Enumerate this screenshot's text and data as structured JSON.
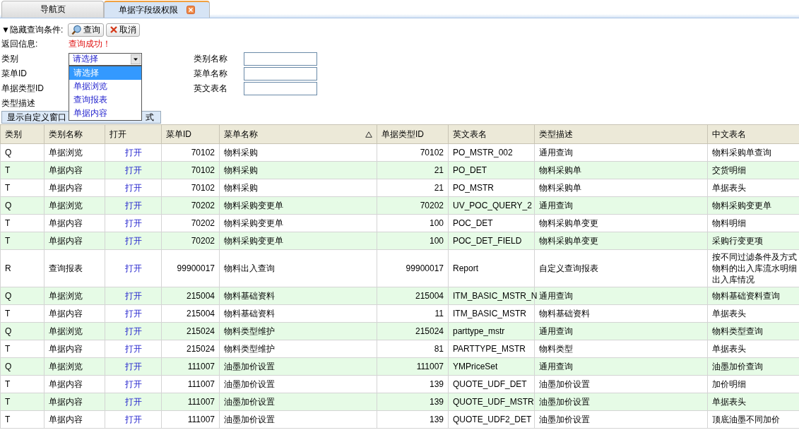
{
  "tabs": [
    {
      "label": "导航页",
      "selected": false,
      "closable": false
    },
    {
      "label": "单据字段级权限",
      "selected": true,
      "closable": true
    }
  ],
  "query_bar": {
    "toggle": "▼隐藏查询条件:",
    "buttons": [
      {
        "kind": "search",
        "label": "查询"
      },
      {
        "kind": "cancel",
        "label": "取消"
      }
    ]
  },
  "return_info": {
    "label": "返回信息:",
    "message": "查询成功！"
  },
  "filters_left": [
    {
      "label": "类别",
      "kind": "select",
      "value": "请选择",
      "expanded": true
    },
    {
      "label": "菜单ID",
      "kind": "hidden"
    },
    {
      "label": "单据类型ID",
      "kind": "hidden"
    },
    {
      "label": "类型描述",
      "kind": "hidden"
    }
  ],
  "filters_right": [
    {
      "label": "类别名称"
    },
    {
      "label": "菜单名称"
    },
    {
      "label": "英文表名"
    }
  ],
  "dropdown_options": [
    {
      "label": "请选择",
      "selected": true
    },
    {
      "label": "单据浏览",
      "selected": false
    },
    {
      "label": "查询报表",
      "selected": false
    },
    {
      "label": "单据内容",
      "selected": false
    }
  ],
  "custom_button": {
    "visible_parts": [
      "显示自定义窗口",
      "式"
    ]
  },
  "table": {
    "columns": [
      {
        "label": "类别",
        "sorted": false
      },
      {
        "label": "类别名称",
        "sorted": false
      },
      {
        "label": "打开",
        "sorted": false
      },
      {
        "label": "菜单ID",
        "sorted": false
      },
      {
        "label": "菜单名称",
        "sorted": true
      },
      {
        "label": "单据类型ID",
        "sorted": false
      },
      {
        "label": "英文表名",
        "sorted": false
      },
      {
        "label": "类型描述",
        "sorted": false
      },
      {
        "label": "中文表名",
        "sorted": false
      }
    ],
    "rows": [
      {
        "cells": [
          "Q",
          "单据浏览",
          "打开",
          "70102",
          "物料采购",
          "70102",
          "PO_MSTR_002",
          "通用查询",
          [
            "物料采购单查询"
          ]
        ]
      },
      {
        "cells": [
          "T",
          "单据内容",
          "打开",
          "70102",
          "物料采购",
          "21",
          "PO_DET",
          "物料采购单",
          [
            "交货明细"
          ]
        ]
      },
      {
        "cells": [
          "T",
          "单据内容",
          "打开",
          "70102",
          "物料采购",
          "21",
          "PO_MSTR",
          "物料采购单",
          [
            "单据表头"
          ]
        ]
      },
      {
        "cells": [
          "Q",
          "单据浏览",
          "打开",
          "70202",
          "物料采购变更单",
          "70202",
          "UV_POC_QUERY_2",
          "通用查询",
          [
            "物料采购变更单"
          ]
        ]
      },
      {
        "cells": [
          "T",
          "单据内容",
          "打开",
          "70202",
          "物料采购变更单",
          "100",
          "POC_DET",
          "物料采购单变更",
          [
            "物料明细"
          ]
        ]
      },
      {
        "cells": [
          "T",
          "单据内容",
          "打开",
          "70202",
          "物料采购变更单",
          "100",
          "POC_DET_FIELD",
          "物料采购单变更",
          [
            "采购行变更项"
          ]
        ]
      },
      {
        "cells": [
          "R",
          "查询报表",
          "打开",
          "99900017",
          "物料出入查询",
          "99900017",
          "Report",
          "自定义查询报表",
          [
            "按不同过滤条件及方式",
            "物料的出入库流水明细",
            "出入库情况"
          ]
        ]
      },
      {
        "cells": [
          "Q",
          "单据浏览",
          "打开",
          "215004",
          "物料基础资料",
          "215004",
          "ITM_BASIC_MSTR_N",
          "通用查询",
          [
            "物料基础资料查询"
          ]
        ]
      },
      {
        "cells": [
          "T",
          "单据内容",
          "打开",
          "215004",
          "物料基础资料",
          "11",
          "ITM_BASIC_MSTR",
          "物料基础资料",
          [
            "单据表头"
          ]
        ]
      },
      {
        "cells": [
          "Q",
          "单据浏览",
          "打开",
          "215024",
          "物料类型维护",
          "215024",
          "parttype_mstr",
          "通用查询",
          [
            "物料类型查询"
          ]
        ]
      },
      {
        "cells": [
          "T",
          "单据内容",
          "打开",
          "215024",
          "物料类型维护",
          "81",
          "PARTTYPE_MSTR",
          "物料类型",
          [
            "单据表头"
          ]
        ]
      },
      {
        "cells": [
          "Q",
          "单据浏览",
          "打开",
          "111007",
          "油墨加价设置",
          "111007",
          "YMPriceSet",
          "通用查询",
          [
            "油墨加价查询"
          ]
        ]
      },
      {
        "cells": [
          "T",
          "单据内容",
          "打开",
          "111007",
          "油墨加价设置",
          "139",
          "QUOTE_UDF_DET",
          "油墨加价设置",
          [
            "加价明细"
          ]
        ]
      },
      {
        "cells": [
          "T",
          "单据内容",
          "打开",
          "111007",
          "油墨加价设置",
          "139",
          "QUOTE_UDF_MSTR",
          "油墨加价设置",
          [
            "单据表头"
          ]
        ]
      },
      {
        "cells": [
          "T",
          "单据内容",
          "打开",
          "111007",
          "油墨加价设置",
          "139",
          "QUOTE_UDF2_DET",
          "油墨加价设置",
          [
            "顶底油墨不同加价"
          ]
        ]
      }
    ]
  }
}
